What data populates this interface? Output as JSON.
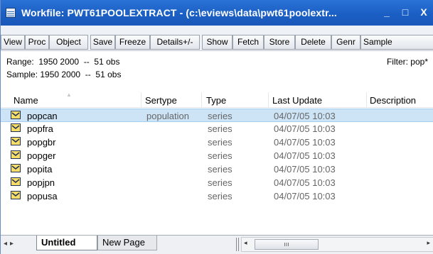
{
  "window": {
    "title": "Workfile: PWT61POOLEXTRACT - (c:\\eviews\\data\\pwt61poolextr...",
    "minimize_glyph": "_",
    "restore_glyph": "□",
    "close_glyph": "X"
  },
  "toolbar": {
    "buttons": [
      "View",
      "Proc",
      "Object",
      "Save",
      "Freeze",
      "Details+/-",
      "Show",
      "Fetch",
      "Store",
      "Delete",
      "Genr",
      "Sample"
    ]
  },
  "info": {
    "range": "Range:  1950 2000  --  51 obs",
    "sample": "Sample: 1950 2000  --  51 obs",
    "filter": "Filter: pop*"
  },
  "columns": {
    "name": "Name",
    "sertype": "Sertype",
    "type": "Type",
    "last_update": "Last Update",
    "description": "Description"
  },
  "rows": [
    {
      "name": "popcan",
      "sertype": "population",
      "type": "series",
      "updated": "04/07/05  10:03",
      "icon": "series-icon",
      "selected": true
    },
    {
      "name": "popfra",
      "sertype": "",
      "type": "series",
      "updated": "04/07/05  10:03",
      "icon": "series-icon"
    },
    {
      "name": "popgbr",
      "sertype": "",
      "type": "series",
      "updated": "04/07/05  10:03",
      "icon": "series-icon"
    },
    {
      "name": "popger",
      "sertype": "",
      "type": "series",
      "updated": "04/07/05  10:03",
      "icon": "series-icon"
    },
    {
      "name": "popita",
      "sertype": "",
      "type": "series",
      "updated": "04/07/05  10:03",
      "icon": "series-icon"
    },
    {
      "name": "popjpn",
      "sertype": "",
      "type": "series",
      "updated": "04/07/05  10:03",
      "icon": "series-icon"
    },
    {
      "name": "popusa",
      "sertype": "",
      "type": "series",
      "updated": "04/07/05  10:03",
      "icon": "series-icon"
    }
  ],
  "tabs": {
    "active": "Untitled",
    "inactive": "New Page"
  },
  "colors": {
    "titlebar": "#1b5fc4",
    "selection": "#cde4f7",
    "icon_fill": "#f6dd6a"
  }
}
